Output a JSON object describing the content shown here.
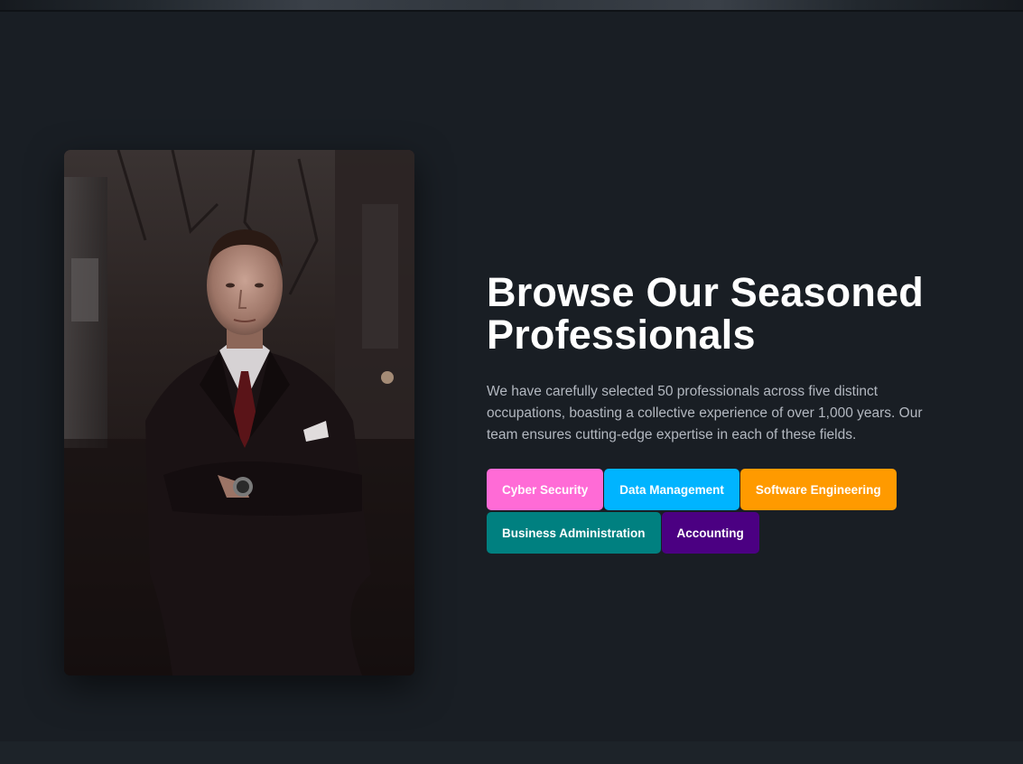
{
  "hero": {
    "title_line1": "Browse Our Seasoned",
    "title_line2": "Professionals",
    "description": "We have carefully selected 50 professionals across five distinct occupations, boasting a collective experience of over 1,000 years. Our team ensures cutting-edge expertise in each of these fields.",
    "photo_alt": "professional-portrait"
  },
  "tags": [
    {
      "label": "Cyber Security",
      "color": "#ff6bd6"
    },
    {
      "label": "Data Management",
      "color": "#00b4ff"
    },
    {
      "label": "Software Engineering",
      "color": "#ff9a00"
    },
    {
      "label": "Business Administration",
      "color": "#008080"
    },
    {
      "label": "Accounting",
      "color": "#4b0082"
    }
  ],
  "theme": {
    "background": "#191e24",
    "title_color": "#ffffff",
    "text_color": "#b3b8c0"
  }
}
